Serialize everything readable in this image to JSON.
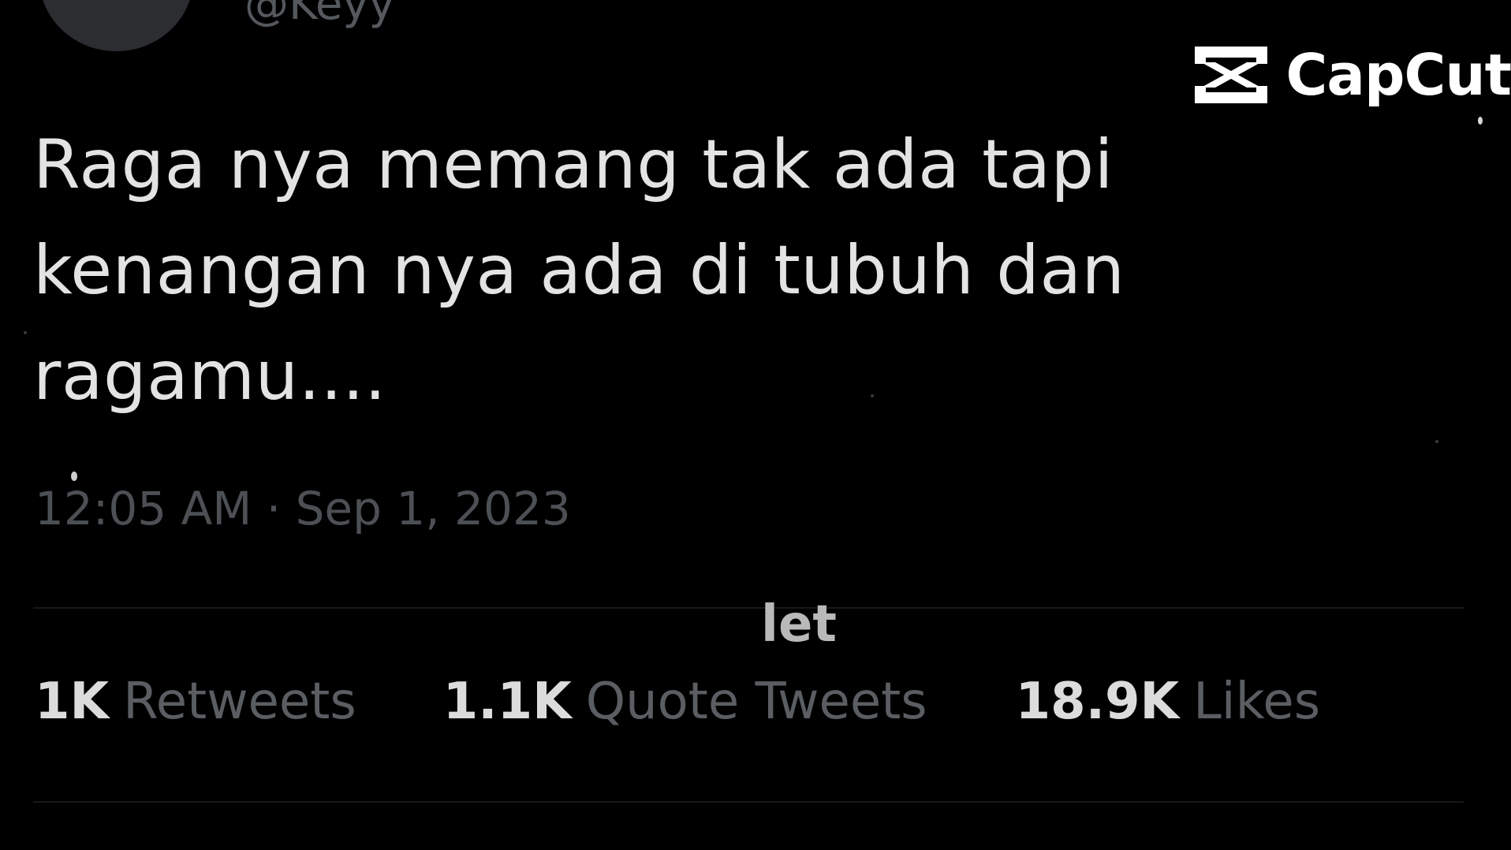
{
  "tweet": {
    "handle": "@Keyy",
    "text_lines": [
      "Raga nya memang tak ada tapi",
      "kenangan nya ada di tubuh dan",
      "ragamu...."
    ],
    "timestamp": "12:05 AM · Sep 1, 2023",
    "stats": {
      "retweets": {
        "count": "1K",
        "label": "Retweets"
      },
      "quote_tweets": {
        "count": "1.1K",
        "label": "Quote Tweets"
      },
      "likes": {
        "count": "18.9K",
        "label": "Likes"
      }
    }
  },
  "overlay": {
    "caption": "let",
    "watermark": {
      "name": "CapCut",
      "icon": "capcut-logo-icon"
    }
  },
  "colors": {
    "background": "#000000",
    "text_primary": "#e3e3e3",
    "text_secondary": "#5a5e62",
    "watermark": "#ffffff"
  }
}
